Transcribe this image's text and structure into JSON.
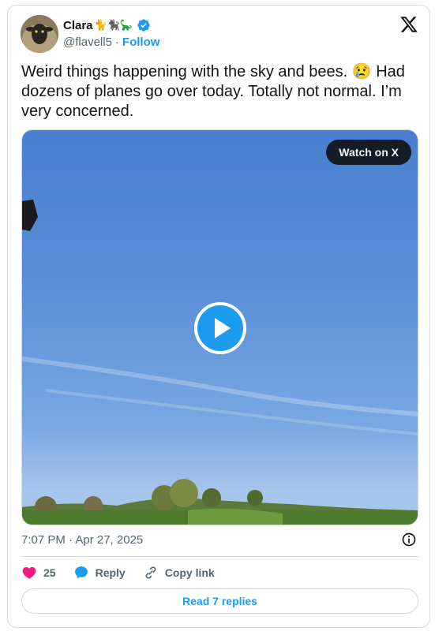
{
  "author": {
    "display_name": "Clara",
    "name_emojis": "🐈🐈‍⬛🦕",
    "handle": "@flavell5",
    "separator": "·",
    "follow_label": "Follow",
    "verified": true
  },
  "tweet": {
    "text": "Weird things happening with the sky and bees. 😢 Had dozens of planes go over today. Totally not normal. I’m very concerned.",
    "timestamp": "7:07 PM · Apr 27, 2025"
  },
  "media": {
    "watch_label": "Watch on X",
    "type": "video"
  },
  "actions": {
    "like_count": "25",
    "reply_label": "Reply",
    "copy_link_label": "Copy link"
  },
  "footer": {
    "read_replies_label": "Read 7 replies"
  },
  "colors": {
    "accent": "#1d9bf0",
    "like": "#f91880",
    "text_primary": "#0f1419",
    "text_secondary": "#536471",
    "border": "#cfd9de"
  },
  "icons": [
    "x-logo-icon",
    "verified-badge-icon",
    "play-icon",
    "info-icon",
    "heart-icon",
    "reply-bubble-icon",
    "link-icon"
  ]
}
